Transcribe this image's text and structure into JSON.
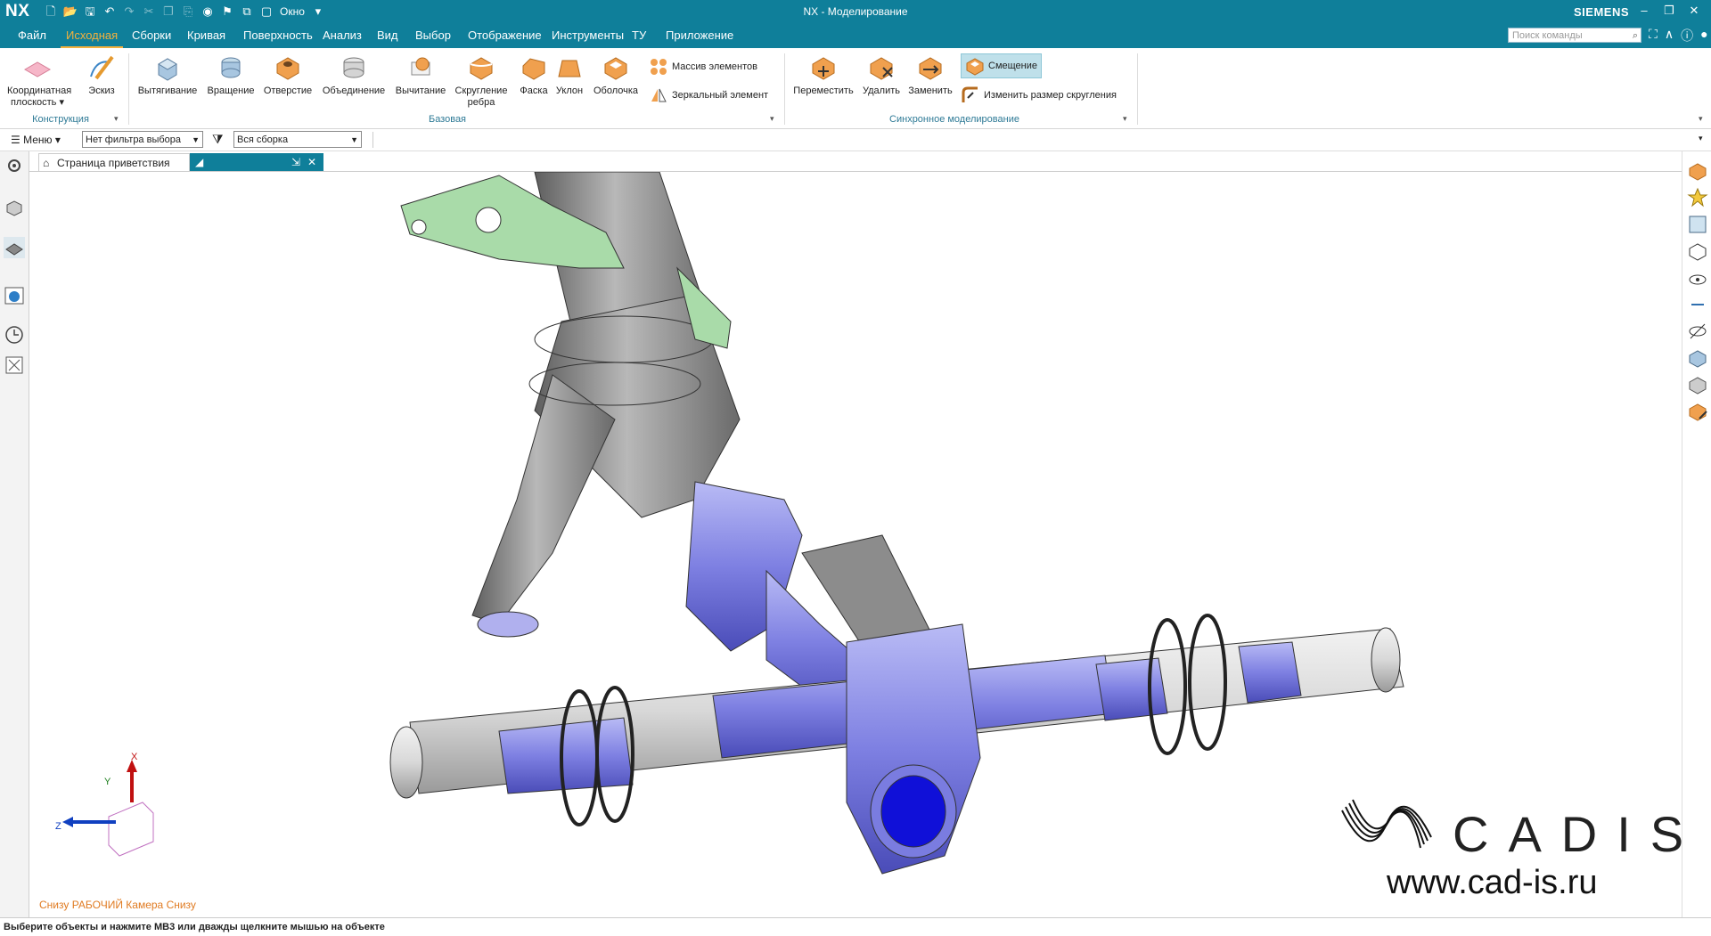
{
  "titlebar": {
    "logo": "NX",
    "window_menu": "Окно",
    "title": "NX - Моделирование",
    "brand": "SIEMENS"
  },
  "menubar": {
    "tabs": [
      "Файл",
      "Исходная",
      "Сборки",
      "Кривая",
      "Поверхность",
      "Анализ",
      "Вид",
      "Выбор",
      "Отображение",
      "Инструменты",
      "ТУ",
      "Приложение"
    ],
    "active_tab": "Исходная",
    "search_placeholder": "Поиск команды"
  },
  "ribbon": {
    "construction": {
      "group_label": "Конструкция",
      "datum_plane_line1": "Координатная",
      "datum_plane_line2": "плоскость",
      "sketch": "Эскиз"
    },
    "base": {
      "group_label": "Базовая",
      "extrude": "Вытягивание",
      "revolve": "Вращение",
      "hole": "Отверстие",
      "unite": "Объединение",
      "subtract": "Вычитание",
      "edge_blend_line1": "Скругление",
      "edge_blend_line2": "ребра",
      "chamfer": "Фаска",
      "draft": "Уклон",
      "shell": "Оболочка",
      "pattern_feature": "Массив элементов",
      "mirror_feature": "Зеркальный элемент"
    },
    "sync": {
      "group_label": "Синхронное моделирование",
      "move": "Переместить",
      "delete": "Удалить",
      "replace": "Заменить",
      "offset": "Смещение",
      "resize_blend": "Изменить размер скругления"
    }
  },
  "selbar": {
    "menu": "Меню",
    "filter": "Нет фильтра выбора",
    "scope": "Вся сборка"
  },
  "doc_tabs": {
    "welcome": "Страница приветствия"
  },
  "viewport": {
    "view_label": "Снизу РАБОЧИЙ Камера Снизу",
    "triad": {
      "x": "X",
      "y": "Y",
      "z": "Z"
    }
  },
  "watermark": {
    "word": "CADIS",
    "url": "www.cad-is.ru"
  },
  "status": {
    "message": "Выберите объекты и нажмите MB3 или дважды щелкните мышью на объекте"
  },
  "colors": {
    "accent": "#0f7f9a",
    "active_tab": "#f3b13d",
    "view_label": "#e07b22",
    "part_gray": "#8c8c8c",
    "part_blue": "#7d7fe0",
    "part_green": "#9ccf9c"
  }
}
